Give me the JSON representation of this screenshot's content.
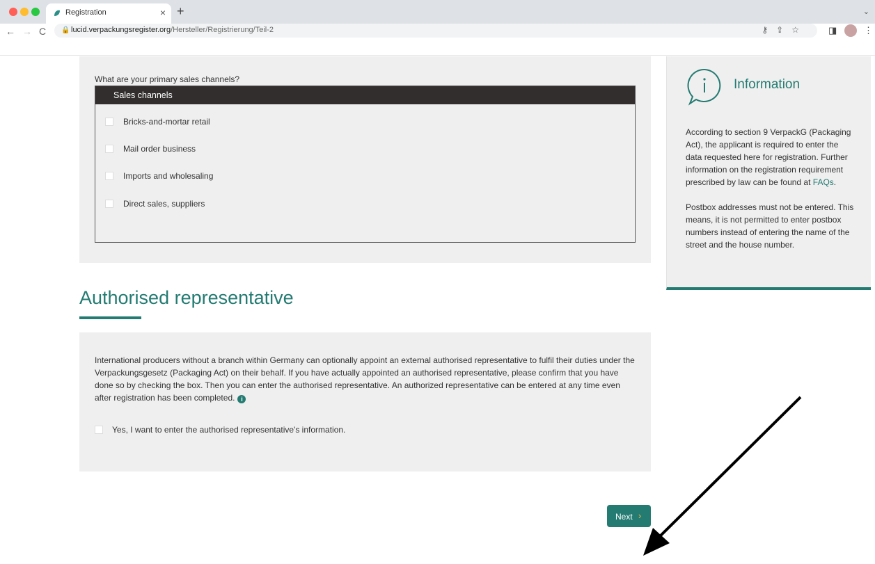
{
  "browser": {
    "tab_title": "Registration",
    "url_domain": "lucid.verpackungsregister.org",
    "url_path": "/Hersteller/Registrierung/Teil-2"
  },
  "sales": {
    "question": "What are your primary sales channels?",
    "header": "Sales channels",
    "options": [
      "Bricks-and-mortar retail",
      "Mail order business",
      "Imports and wholesaling",
      "Direct sales, suppliers"
    ]
  },
  "representative": {
    "title": "Authorised representative",
    "paragraph": "International producers without a branch within Germany can optionally appoint an external authorised representative to fulfil their duties under the Verpackungsgesetz (Packaging Act) on their behalf. If you have actually appointed an authorised representative, please confirm that you have done so by checking the box. Then you can enter the authorised representative. An authorized representative can be entered at any time even after registration has been completed.",
    "info_glyph": "i",
    "checkbox_label": "Yes, I want to enter the authorised representative's information."
  },
  "next_button": "Next",
  "info_panel": {
    "title": "Information",
    "text1_before": "According to section 9 VerpackG (Packaging Act), the applicant is required to enter the data requested here for registration. Further information on the registration requirement prescribed by law can be found at ",
    "text1_link": "FAQs",
    "text1_after": ".",
    "text2": "Postbox addresses must not be entered. This means, it is not permitted to enter postbox numbers instead of entering the name of the street and the house number."
  },
  "colors": {
    "accent": "#237b72",
    "header_dark": "#332e2e",
    "panel_bg": "#efefef",
    "next_chevron": "#f2b640"
  }
}
